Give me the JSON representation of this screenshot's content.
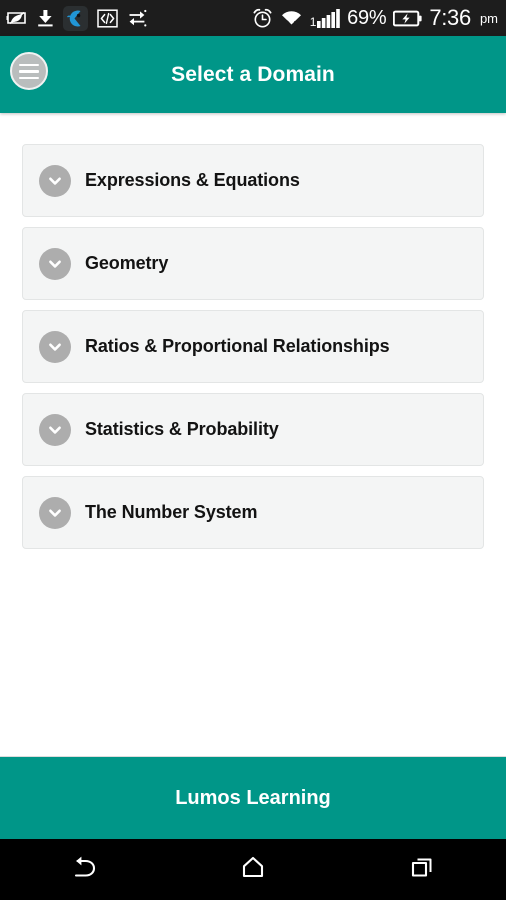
{
  "status_bar": {
    "left_icons": [
      {
        "name": "battery-saver-leaf-icon"
      },
      {
        "name": "download-icon"
      },
      {
        "name": "app-notification-icon"
      },
      {
        "name": "developer-code-icon"
      },
      {
        "name": "data-transfer-icon"
      }
    ],
    "right_icons": [
      {
        "name": "alarm-clock-icon"
      },
      {
        "name": "wifi-icon"
      },
      {
        "name": "cellular-signal-icon"
      }
    ],
    "signal_label": "1",
    "battery_percent": "69%",
    "time": "7:36",
    "meridiem": "pm"
  },
  "app_bar": {
    "menu_icon": "hamburger-menu-icon",
    "title": "Select a Domain",
    "background_color": "#009688"
  },
  "main": {
    "domains": [
      {
        "label": "Expressions & Equations",
        "expand_icon": "chevron-down-icon"
      },
      {
        "label": "Geometry",
        "expand_icon": "chevron-down-icon"
      },
      {
        "label": "Ratios & Proportional Relationships",
        "expand_icon": "chevron-down-icon"
      },
      {
        "label": "Statistics & Probability",
        "expand_icon": "chevron-down-icon"
      },
      {
        "label": "The Number System",
        "expand_icon": "chevron-down-icon"
      }
    ],
    "card_background_color": "#F4F5F5",
    "chevron_circle_color": "#ADADAD"
  },
  "footer": {
    "brand": "Lumos Learning",
    "background_color": "#009688"
  },
  "nav_bar": {
    "buttons": [
      {
        "name": "back-button",
        "icon": "back-arrow-icon"
      },
      {
        "name": "home-button",
        "icon": "home-icon"
      },
      {
        "name": "recents-button",
        "icon": "recent-apps-icon"
      }
    ]
  }
}
